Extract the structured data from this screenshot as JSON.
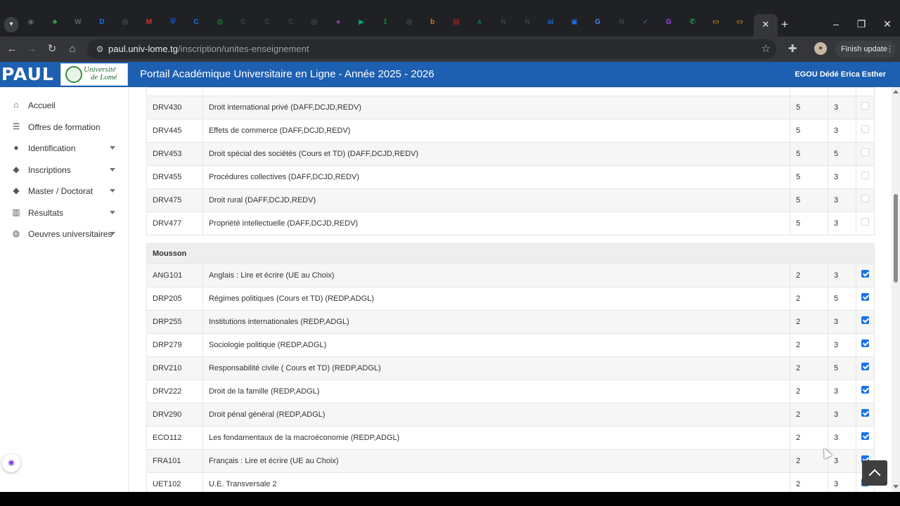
{
  "browser": {
    "url_host": "paul.univ-lome.tg",
    "url_path": "/inscription/unites-enseignement",
    "finish_update": "Finish update",
    "tab_favicons": [
      {
        "icon": "chrome-icon",
        "glyph": "◉",
        "color": "#5f6368"
      },
      {
        "icon": "leaf-icon",
        "glyph": "♣",
        "color": "#34a853"
      },
      {
        "icon": "w-icon",
        "glyph": "W",
        "color": "#5f6368"
      },
      {
        "icon": "d-icon",
        "glyph": "D",
        "color": "#1a73e8"
      },
      {
        "icon": "circle-icon",
        "glyph": "◎",
        "color": "#5f6368"
      },
      {
        "icon": "gmail-icon",
        "glyph": "M",
        "color": "#d93025"
      },
      {
        "icon": "shield-icon",
        "glyph": "⛨",
        "color": "#0b57d0"
      },
      {
        "icon": "c-icon",
        "glyph": "C",
        "color": "#1a73e8"
      },
      {
        "icon": "globe-icon",
        "glyph": "◍",
        "color": "#188038"
      },
      {
        "icon": "c-box-icon",
        "glyph": "C",
        "color": "#3c4043"
      },
      {
        "icon": "c-box-icon",
        "glyph": "C",
        "color": "#3c4043"
      },
      {
        "icon": "c-box-icon",
        "glyph": "C",
        "color": "#3c4043"
      },
      {
        "icon": "circle-icon",
        "glyph": "◎",
        "color": "#5f6368"
      },
      {
        "icon": "ball-icon",
        "glyph": "●",
        "color": "#8e44ad"
      },
      {
        "icon": "play-icon",
        "glyph": "▶",
        "color": "#00a67e"
      },
      {
        "icon": "arrow-icon",
        "glyph": "↥",
        "color": "#188038"
      },
      {
        "icon": "circle-icon",
        "glyph": "◎",
        "color": "#5f6368"
      },
      {
        "icon": "b-icon",
        "glyph": "b",
        "color": "#e8710a"
      },
      {
        "icon": "doc-icon",
        "glyph": "▤",
        "color": "#c5221f"
      },
      {
        "icon": "chart-icon",
        "glyph": "∧",
        "color": "#137333"
      },
      {
        "icon": "notion-icon",
        "glyph": "N",
        "color": "#3c4043"
      },
      {
        "icon": "notion-icon",
        "glyph": "N",
        "color": "#3c4043"
      },
      {
        "icon": "ai-icon",
        "glyph": "ai",
        "color": "#1967d2"
      },
      {
        "icon": "photo-icon",
        "glyph": "▣",
        "color": "#1a73e8"
      },
      {
        "icon": "google-icon",
        "glyph": "G",
        "color": "#4285f4"
      },
      {
        "icon": "notion-icon",
        "glyph": "N",
        "color": "#3c4043"
      },
      {
        "icon": "check-icon",
        "glyph": "✓",
        "color": "#5b5fc7"
      },
      {
        "icon": "g-icon",
        "glyph": "G",
        "color": "#a142f4"
      },
      {
        "icon": "whatsapp-icon",
        "glyph": "✆",
        "color": "#25d366"
      },
      {
        "icon": "slides-icon",
        "glyph": "▭",
        "color": "#f9ab00"
      },
      {
        "icon": "slides-icon",
        "glyph": "▭",
        "color": "#f9ab00"
      }
    ]
  },
  "header": {
    "logo_text": "PAUL",
    "university_line1": "Université",
    "university_line2": "de Lomé",
    "title": "Portail Académique Universitaire en Ligne - Année 2025 - 2026",
    "user": "EGOU Dédé Erica Esther"
  },
  "sidebar": {
    "items": [
      {
        "label": "Accueil",
        "icon": "home-icon",
        "glyph": "⌂",
        "has_caret": false
      },
      {
        "label": "Offres de formation",
        "icon": "list-icon",
        "glyph": "☰",
        "has_caret": false
      },
      {
        "label": "Identification",
        "icon": "user-icon",
        "glyph": "●",
        "has_caret": true
      },
      {
        "label": "Inscriptions",
        "icon": "graduation-cap-icon",
        "glyph": "◆",
        "has_caret": true
      },
      {
        "label": "Master / Doctorat",
        "icon": "graduation-cap-icon",
        "glyph": "◆",
        "has_caret": true
      },
      {
        "label": "Résultats",
        "icon": "bar-chart-icon",
        "glyph": "▥",
        "has_caret": true
      },
      {
        "label": "Oeuvres universitaires",
        "icon": "globe-icon",
        "glyph": "◍",
        "has_caret": true
      }
    ]
  },
  "table": {
    "rows": [
      {
        "kind": "topcut"
      },
      {
        "kind": "row",
        "code": "DRV430",
        "title": "Droit international privé (DAFF,DCJD,REDV)",
        "credits": "5",
        "coef": "3",
        "checked": false
      },
      {
        "kind": "row",
        "code": "DRV445",
        "title": "Effets de commerce (DAFF,DCJD,REDV)",
        "credits": "5",
        "coef": "3",
        "checked": false
      },
      {
        "kind": "row",
        "code": "DRV453",
        "title": "Droit spécial des sociétés (Cours et TD) (DAFF,DCJD,REDV)",
        "credits": "5",
        "coef": "5",
        "checked": false
      },
      {
        "kind": "row",
        "code": "DRV455",
        "title": "Procédures collectives (DAFF,DCJD,REDV)",
        "credits": "5",
        "coef": "3",
        "checked": false
      },
      {
        "kind": "row",
        "code": "DRV475",
        "title": "Droit rural (DAFF,DCJD,REDV)",
        "credits": "5",
        "coef": "3",
        "checked": false
      },
      {
        "kind": "row",
        "code": "DRV477",
        "title": "Propriété intellectuelle (DAFF,DCJD,REDV)",
        "credits": "5",
        "coef": "3",
        "checked": false
      },
      {
        "kind": "spacer"
      },
      {
        "kind": "group",
        "label": "Mousson"
      },
      {
        "kind": "row",
        "code": "ANG101",
        "title": "Anglais : Lire et écrire (UE au Choix)",
        "credits": "2",
        "coef": "3",
        "checked": true
      },
      {
        "kind": "row",
        "code": "DRP205",
        "title": "Régimes politiques (Cours et TD) (REDP,ADGL)",
        "credits": "2",
        "coef": "5",
        "checked": true
      },
      {
        "kind": "row",
        "code": "DRP255",
        "title": "Institutions internationales (REDP,ADGL)",
        "credits": "2",
        "coef": "3",
        "checked": true
      },
      {
        "kind": "row",
        "code": "DRP279",
        "title": "Sociologie politique (REDP,ADGL)",
        "credits": "2",
        "coef": "3",
        "checked": true
      },
      {
        "kind": "row",
        "code": "DRV210",
        "title": "Responsabilité civile ( Cours et TD) (REDP,ADGL)",
        "credits": "2",
        "coef": "5",
        "checked": true
      },
      {
        "kind": "row",
        "code": "DRV222",
        "title": "Droit de la famille (REDP,ADGL)",
        "credits": "2",
        "coef": "3",
        "checked": true
      },
      {
        "kind": "row",
        "code": "DRV290",
        "title": "Droit pénal général (REDP,ADGL)",
        "credits": "2",
        "coef": "3",
        "checked": true
      },
      {
        "kind": "row",
        "code": "ECO112",
        "title": "Les fondamentaux de la macroéconomie (REDP,ADGL)",
        "credits": "2",
        "coef": "3",
        "checked": true
      },
      {
        "kind": "row",
        "code": "FRA101",
        "title": "Français : Lire et écrire (UE au Choix)",
        "credits": "2",
        "coef": "3",
        "checked": true
      },
      {
        "kind": "row",
        "code": "UET102",
        "title": "U.E. Transversale 2",
        "credits": "2",
        "coef": "3",
        "checked": true
      }
    ]
  }
}
